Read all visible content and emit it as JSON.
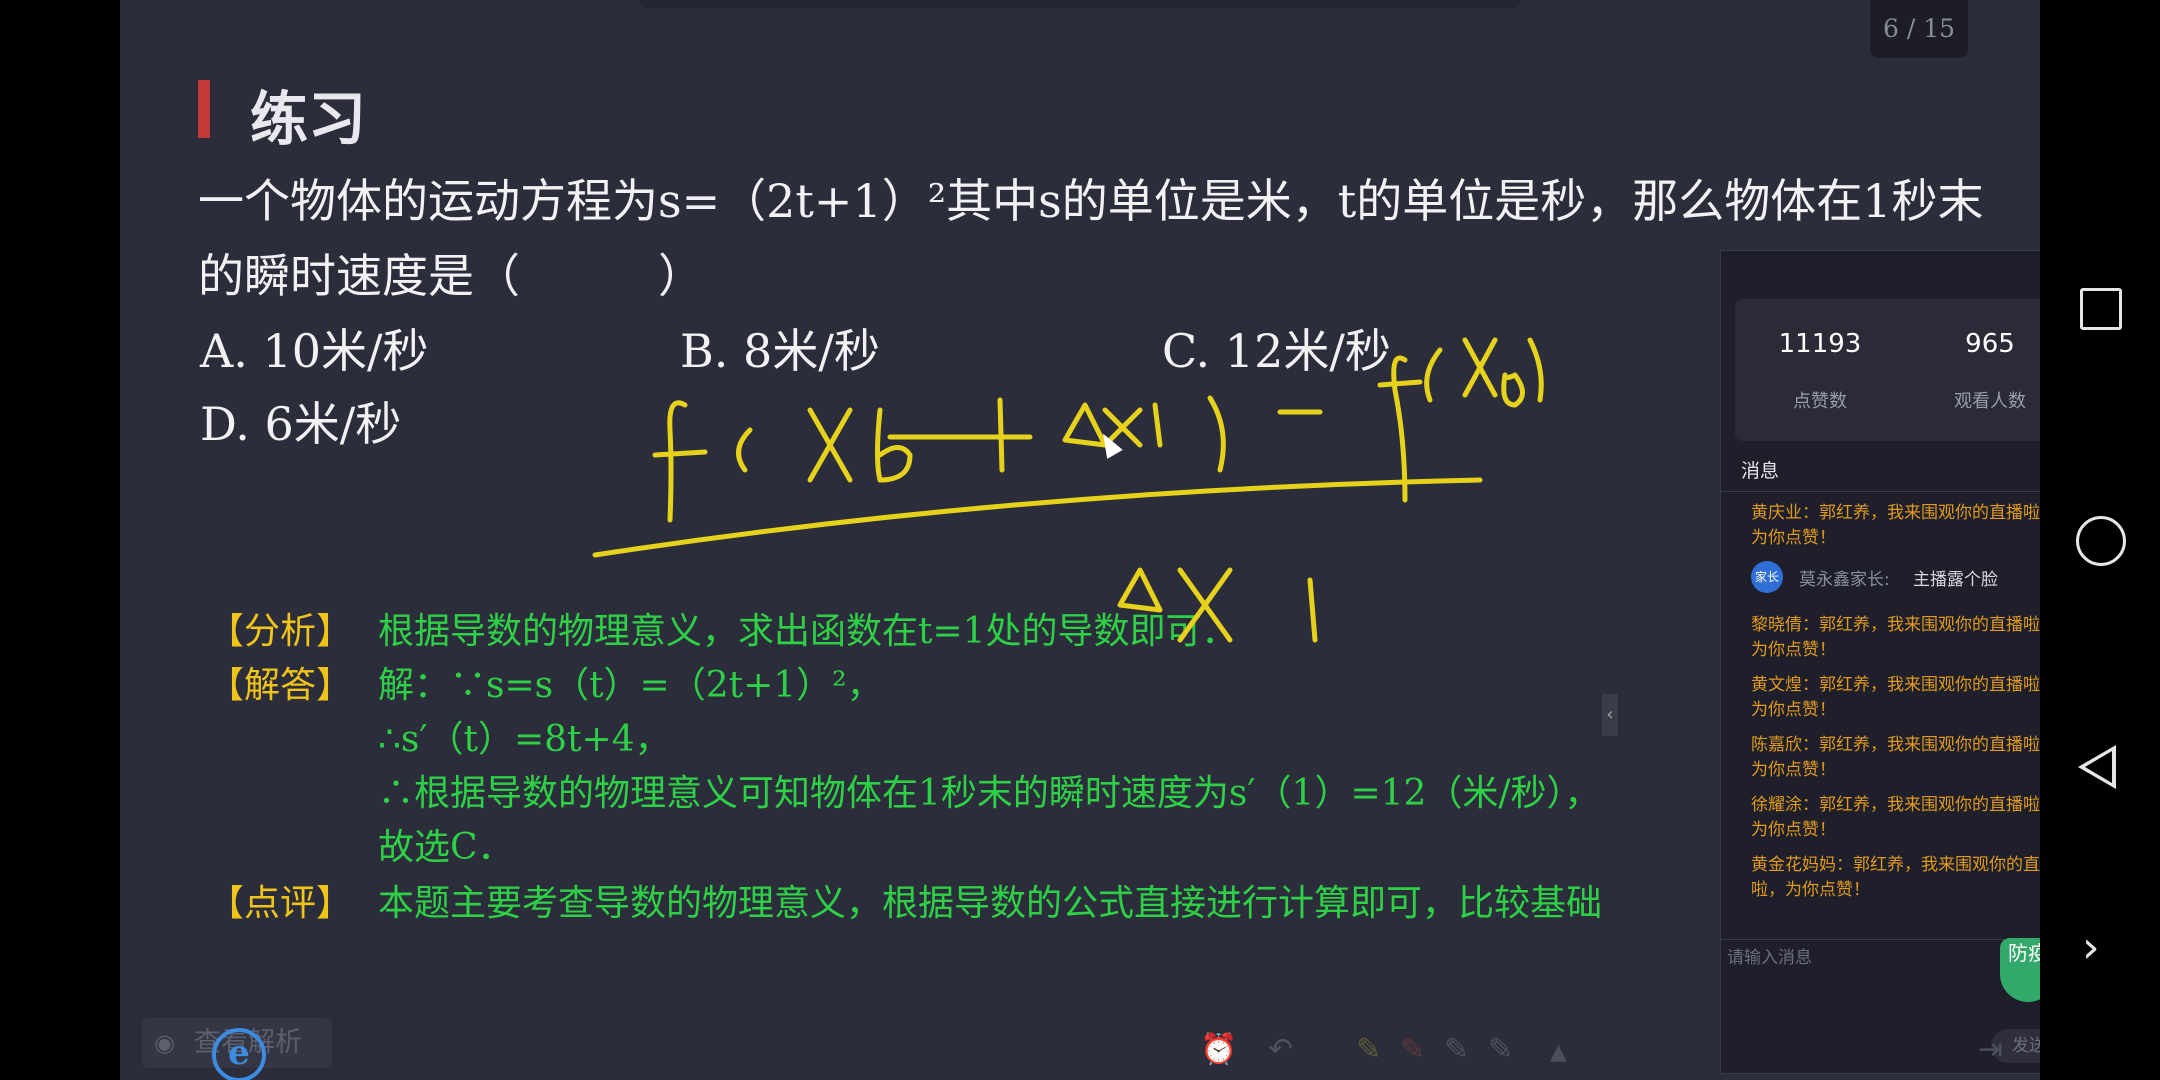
{
  "page": {
    "indicator": "6 / 15",
    "title": "练习"
  },
  "question": {
    "line1": "一个物体的运动方程为s=（2t+1）²其中s的单位是米，t的单位是秒，那么物体在1秒末",
    "line2": "的瞬时速度是（　　　）"
  },
  "options": [
    {
      "label": "A. 10米/秒"
    },
    {
      "label": "B. 8米/秒"
    },
    {
      "label": "C. 12米/秒"
    },
    {
      "label": "D. 6米/秒"
    }
  ],
  "analysis": {
    "label": "【分析】",
    "text": "根据导数的物理意义，求出函数在t=1处的导数即可．"
  },
  "solution": {
    "label": "【解答】",
    "lines": [
      "解：∵s=s（t）=（2t+1）²，",
      "∴s′（t）=8t+4，",
      "∴根据导数的物理意义可知物体在1秒末的瞬时速度为s′（1）=12（米/秒），",
      "故选C．"
    ]
  },
  "review": {
    "label": "【点评】",
    "text": "本题主要考查导数的物理意义，根据导数的公式直接进行计算即可，比较基础"
  },
  "chat": {
    "close": "×",
    "likes": "11193",
    "likes_label": "点赞数",
    "viewers": "965",
    "viewers_label": "观看人数",
    "messages_title": "消息",
    "messages": [
      "黄庆业：郭红养，我来围观你的直播啦，为你点赞！",
      "黎晓倩：郭红养，我来围观你的直播啦，为你点赞！",
      "黄文煌：郭红养，我来围观你的直播啦，为你点赞！",
      "陈嘉欣：郭红养，我来围观你的直播啦，为你点赞！",
      "徐耀涂：郭红养，我来围观你的直播啦，为你点赞！",
      "黄金花妈妈：郭红养，我来围观你的直播啦，为你点赞！"
    ],
    "parent_msg": {
      "badge": "家长",
      "name": "莫永鑫家长:",
      "text": "主播露个脸"
    },
    "input_placeholder": "请输入消息",
    "send_label": "发送"
  },
  "badge": "防疫",
  "toolbar": {
    "analysis_label": "查看解析",
    "ie": "e"
  },
  "colors": {
    "accent_red": "#c23a3a",
    "label_yellow": "#f0c419",
    "answer_green": "#2ed046",
    "ink_yellow": "#e6d21a",
    "chat_orange": "#e09a1c"
  }
}
